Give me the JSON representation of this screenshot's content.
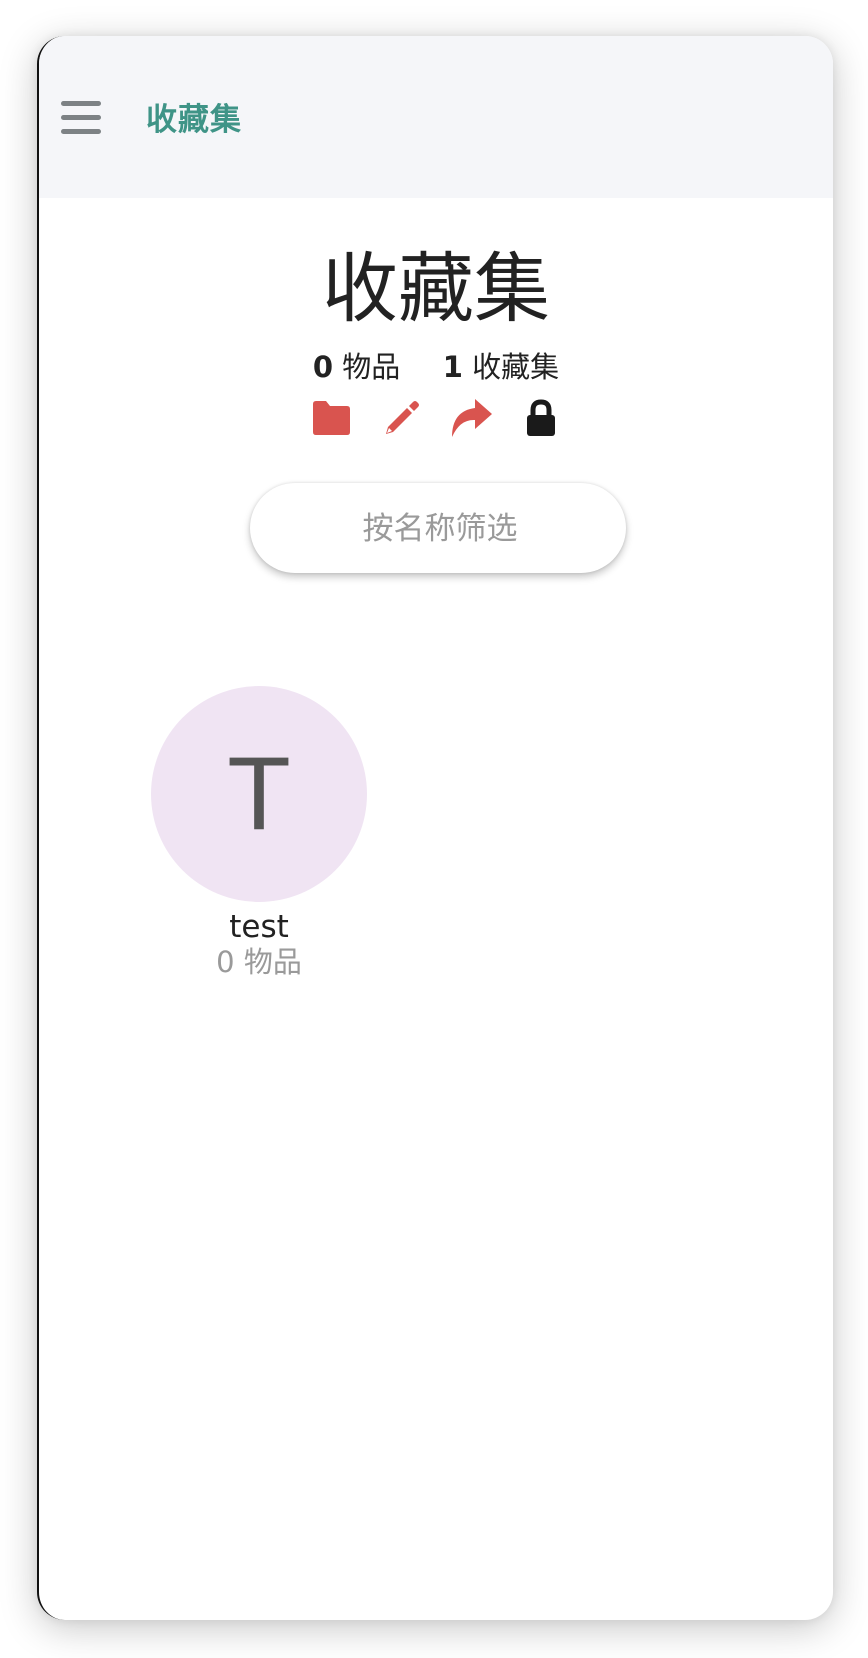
{
  "appbar": {
    "title": "收藏集",
    "menu_icon": "hamburger-menu-icon"
  },
  "header": {
    "title": "收藏集",
    "items_count": "0",
    "items_label": "物品",
    "collections_count": "1",
    "collections_label": "收藏集"
  },
  "actions": [
    {
      "icon": "folder-icon",
      "color": "#d9544f"
    },
    {
      "icon": "pencil-icon",
      "color": "#d9544f"
    },
    {
      "icon": "share-icon",
      "color": "#d9544f"
    },
    {
      "icon": "lock-icon",
      "color": "#1a1a1a"
    }
  ],
  "filter": {
    "placeholder": "按名称筛选"
  },
  "collections": [
    {
      "initial": "T",
      "name": "test",
      "count_text": "0 物品",
      "avatar_color": "#f0e4f3"
    }
  ],
  "colors": {
    "accent": "#3f9487",
    "action_red": "#d9544f",
    "appbar_bg": "#f5f6f9"
  }
}
